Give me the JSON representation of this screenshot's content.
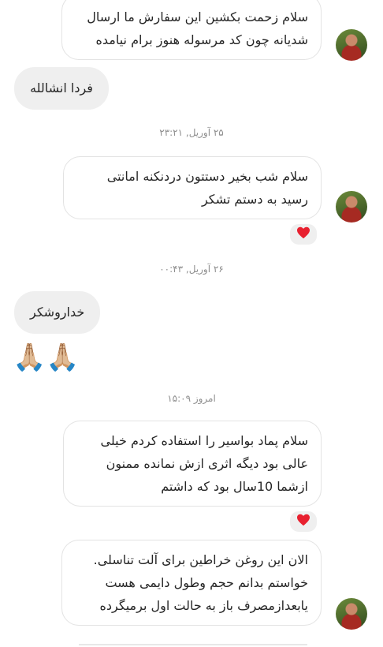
{
  "messages": [
    {
      "lines": [
        "سلام زحمت بکشین این سفارش ما ارسال",
        "شدیانه چون کد مرسوله هنوز برام نیامده"
      ]
    },
    {
      "text": "فردا انشالله"
    },
    {
      "lines": [
        "سلام شب بخیر دستتون دردنکنه امانتی",
        "رسید به دستم تشکر"
      ]
    },
    {
      "text": "خداروشکر"
    },
    {
      "emoji": "🙏🏼🙏🏼"
    },
    {
      "lines": [
        "سلام پماد بواسیر را استفاده کردم خیلی",
        "عالی بود دیگه اثری ازش نمانده ممنون",
        "ازشما 10سال بود که داشتم"
      ]
    },
    {
      "lines": [
        "الان این روغن خراطین برای آلت تناسلی.",
        "خواستم بدانم حجم وطول دایمی هست",
        "یابعدازمصرف باز به حالت اول برمیگرده"
      ]
    }
  ],
  "timestamps": [
    "۲۵ آوریل, ۲۳:۲۱",
    "۲۶ آوریل, ۰۰:۴۳",
    "امروز ۱۵:۰۹"
  ],
  "reaction_emoji": "❤️",
  "colors": {
    "incoming_border": "#e3e3e3",
    "outgoing_bg": "#efefef",
    "timestamp": "#8e8e8e",
    "heart": "#e8202f"
  }
}
